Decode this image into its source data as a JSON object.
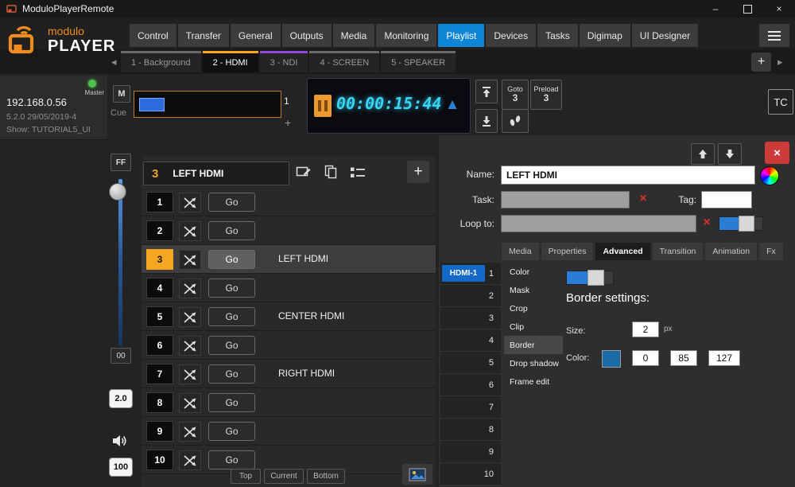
{
  "titlebar": {
    "title": "ModuloPlayerRemote"
  },
  "icons": {
    "minimize": "–",
    "close": "×",
    "clear": "×",
    "tab_prev": "◂",
    "tab_next": "▸",
    "plus": "+",
    "up_triangle": "▲"
  },
  "nav": {
    "tabs": [
      "Control",
      "Transfer",
      "General",
      "Outputs",
      "Media",
      "Monitoring",
      "Playlist",
      "Devices",
      "Tasks",
      "Digimap",
      "UI Designer"
    ],
    "active_tab": "Playlist"
  },
  "logo": {
    "line1": "modulo",
    "line2": "PLAYER"
  },
  "playlist_tabs": {
    "items": [
      "1 - Background",
      "2 - HDMI",
      "3 - NDI",
      "4 - SCREEN",
      "5 - SPEAKER"
    ],
    "active": "2 - HDMI"
  },
  "status": {
    "master": "Master",
    "ip": "192.168.0.56",
    "version": "5.2.0 29/05/2019-4",
    "show": "Show: TUTORIAL5_UI"
  },
  "left_rail": {
    "ff": "FF",
    "zero": "00",
    "rate": "2.0",
    "volume": "100"
  },
  "cue": {
    "m": "M",
    "label": "Cue",
    "slot": "1"
  },
  "timecode": {
    "value": "00:00:15:44"
  },
  "transport": {
    "goto_label": "Goto",
    "goto_value": "3",
    "preload_label": "Preload",
    "preload_value": "3",
    "tc": "TC"
  },
  "playlist": {
    "header_num": "3",
    "header_name": "LEFT HDMI",
    "go_label": "Go",
    "rows": [
      {
        "num": "1",
        "label": ""
      },
      {
        "num": "2",
        "label": ""
      },
      {
        "num": "3",
        "label": "LEFT HDMI"
      },
      {
        "num": "4",
        "label": ""
      },
      {
        "num": "5",
        "label": "CENTER HDMI"
      },
      {
        "num": "6",
        "label": ""
      },
      {
        "num": "7",
        "label": "RIGHT HDMI"
      },
      {
        "num": "8",
        "label": ""
      },
      {
        "num": "9",
        "label": ""
      },
      {
        "num": "10",
        "label": ""
      }
    ],
    "footer": {
      "top": "Top",
      "current": "Current",
      "bottom": "Bottom"
    }
  },
  "editor": {
    "name_label": "Name:",
    "name_value": "LEFT HDMI",
    "task_label": "Task:",
    "task_value": "",
    "tag_label": "Tag:",
    "tag_value": "",
    "loop_label": "Loop to:",
    "loop_value": "",
    "tabs": [
      "Media",
      "Properties",
      "Advanced",
      "Transition",
      "Animation",
      "Fx"
    ],
    "active_tab": "Advanced",
    "layers": {
      "name": "HDMI-1",
      "cues": [
        "1",
        "2",
        "3",
        "4",
        "5",
        "6",
        "7",
        "8",
        "9",
        "10"
      ]
    },
    "menu": {
      "items": [
        "Color",
        "Mask",
        "Crop",
        "Clip",
        "Border",
        "Drop shadow",
        "Frame edit"
      ],
      "selected": "Border"
    },
    "border": {
      "title": "Border settings:",
      "size_label": "Size:",
      "size_value": "2",
      "size_unit": "px",
      "color_label": "Color:",
      "color_hex": "#1a6ba6",
      "values": [
        "0",
        "85",
        "127"
      ]
    }
  },
  "colors": {
    "nav_active_blue": "#0e86d7",
    "playlist_accent_orange": "#f5a623",
    "ndi_accent_purple": "#9048d8",
    "timecode_cyan": "#38d6f4",
    "delete_red": "#cc3a3a",
    "layer_blue": "#1468c8",
    "master_green": "#4cc24c"
  }
}
